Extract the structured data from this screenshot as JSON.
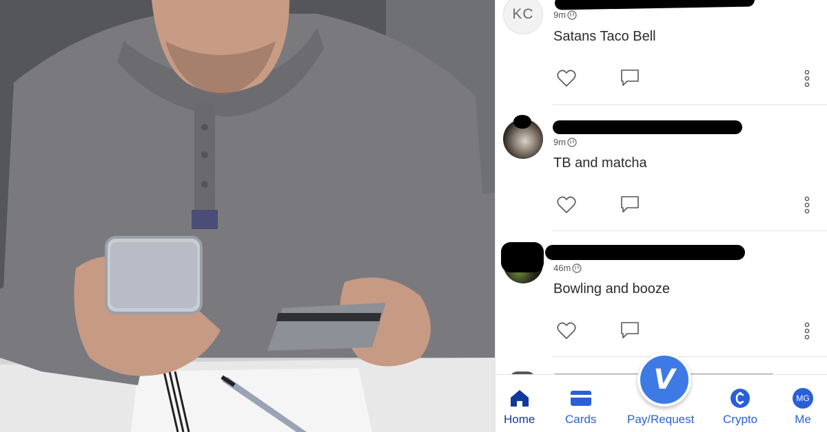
{
  "feed": [
    {
      "avatar_initials": "KC",
      "time": "9m",
      "note": "Satans Taco Bell"
    },
    {
      "avatar_initials": "",
      "time": "9m",
      "note": "TB and matcha"
    },
    {
      "avatar_initials": "",
      "time": "46m",
      "note": "Bowling and booze"
    }
  ],
  "nav": {
    "home": "Home",
    "cards": "Cards",
    "pay_request": "Pay/Request",
    "crypto": "Crypto",
    "me": "Me",
    "me_initials": "MG",
    "venmo_glyph": "V"
  },
  "colors": {
    "accent": "#3d7ae6",
    "nav_active": "#10399e",
    "nav_inactive": "#2a5fd8"
  }
}
